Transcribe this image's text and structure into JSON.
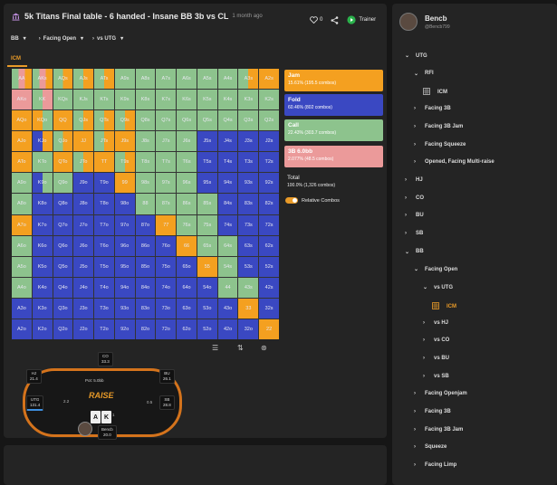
{
  "header": {
    "title": "5k Titans Final table - 6 handed - Insane BB 3b vs CL",
    "time": "1 month ago",
    "like_count": "0",
    "trainer_label": "Trainer"
  },
  "selectors": [
    "BB",
    "Facing Open",
    "vs UTG"
  ],
  "active_tab": "ICM",
  "grid": {
    "labels": [
      [
        "AA",
        "AKs",
        "AQs",
        "AJs",
        "ATs",
        "A9s",
        "A8s",
        "A7s",
        "A6s",
        "A5s",
        "A4s",
        "A3s",
        "A2s"
      ],
      [
        "AKo",
        "KK",
        "KQs",
        "KJs",
        "KTs",
        "K9s",
        "K8s",
        "K7s",
        "K6s",
        "K5s",
        "K4s",
        "K3s",
        "K2s"
      ],
      [
        "AQo",
        "KQo",
        "QQ",
        "QJs",
        "QTs",
        "Q9s",
        "Q8s",
        "Q7s",
        "Q6s",
        "Q5s",
        "Q4s",
        "Q3s",
        "Q2s"
      ],
      [
        "AJo",
        "KJo",
        "QJo",
        "JJ",
        "JTs",
        "J9s",
        "J8s",
        "J7s",
        "J6s",
        "J5s",
        "J4s",
        "J3s",
        "J2s"
      ],
      [
        "ATo",
        "KTo",
        "QTo",
        "JTo",
        "TT",
        "T9s",
        "T8s",
        "T7s",
        "T6s",
        "T5s",
        "T4s",
        "T3s",
        "T2s"
      ],
      [
        "A9o",
        "K9o",
        "Q9o",
        "J9o",
        "T9o",
        "99",
        "98s",
        "97s",
        "96s",
        "95s",
        "94s",
        "93s",
        "92s"
      ],
      [
        "A8o",
        "K8o",
        "Q8o",
        "J8o",
        "T8o",
        "98o",
        "88",
        "87s",
        "86s",
        "85s",
        "84s",
        "83s",
        "82s"
      ],
      [
        "A7o",
        "K7o",
        "Q7o",
        "J7o",
        "T7o",
        "97o",
        "87o",
        "77",
        "76s",
        "75s",
        "74s",
        "73s",
        "72s"
      ],
      [
        "A6o",
        "K6o",
        "Q6o",
        "J6o",
        "T6o",
        "96o",
        "86o",
        "76o",
        "66",
        "65s",
        "64s",
        "63s",
        "62s"
      ],
      [
        "A5o",
        "K5o",
        "Q5o",
        "J5o",
        "T5o",
        "95o",
        "85o",
        "75o",
        "65o",
        "55",
        "54s",
        "53s",
        "52s"
      ],
      [
        "A4o",
        "K4o",
        "Q4o",
        "J4o",
        "T4o",
        "94o",
        "84o",
        "74o",
        "64o",
        "54o",
        "44",
        "43s",
        "42s"
      ],
      [
        "A3o",
        "K3o",
        "Q3o",
        "J3o",
        "T3o",
        "93o",
        "83o",
        "73o",
        "63o",
        "53o",
        "43o",
        "33",
        "32s"
      ],
      [
        "A2o",
        "K2o",
        "Q2o",
        "J2o",
        "T2o",
        "92o",
        "82o",
        "72o",
        "62o",
        "52o",
        "42o",
        "32o",
        "22"
      ]
    ],
    "actions": [
      [
        "CRJ",
        "CRJ",
        "CJ",
        "CJ",
        "CJ",
        "C",
        "C",
        "C",
        "C",
        "C",
        "C",
        "CJ",
        "J"
      ],
      [
        "R",
        "CR",
        "C",
        "C",
        "C",
        "C",
        "C",
        "C",
        "C",
        "C",
        "C",
        "C",
        "C"
      ],
      [
        "J",
        "JC",
        "J",
        "CJ",
        "CJ",
        "CJ",
        "C",
        "C",
        "C",
        "C",
        "C",
        "C",
        "C"
      ],
      [
        "J",
        "FJ",
        "CJ",
        "J",
        "CJ",
        "J",
        "C",
        "C",
        "C",
        "F",
        "F",
        "F",
        "F"
      ],
      [
        "J",
        "C",
        "J",
        "CJ",
        "J",
        "CJ",
        "C",
        "C",
        "C",
        "F",
        "F",
        "F",
        "F"
      ],
      [
        "C",
        "FC",
        "C",
        "F",
        "F",
        "J",
        "C",
        "C",
        "C",
        "F",
        "F",
        "F",
        "F"
      ],
      [
        "C",
        "F",
        "F",
        "F",
        "F",
        "F",
        "C",
        "C",
        "C",
        "C",
        "F",
        "F",
        "F"
      ],
      [
        "J",
        "F",
        "F",
        "F",
        "F",
        "F",
        "F",
        "J",
        "C",
        "C",
        "F",
        "F",
        "F"
      ],
      [
        "C",
        "F",
        "F",
        "F",
        "F",
        "F",
        "F",
        "F",
        "J",
        "C",
        "C",
        "F",
        "F"
      ],
      [
        "C",
        "F",
        "F",
        "F",
        "F",
        "F",
        "F",
        "F",
        "F",
        "J",
        "C",
        "F",
        "F"
      ],
      [
        "C",
        "F",
        "F",
        "F",
        "F",
        "F",
        "F",
        "F",
        "F",
        "F",
        "C",
        "C",
        "F"
      ],
      [
        "F",
        "F",
        "F",
        "F",
        "F",
        "F",
        "F",
        "F",
        "F",
        "F",
        "F",
        "J",
        "F"
      ],
      [
        "F",
        "F",
        "F",
        "F",
        "F",
        "F",
        "F",
        "F",
        "F",
        "F",
        "F",
        "F",
        "J"
      ]
    ]
  },
  "legend": [
    {
      "name": "Jam",
      "pct": "15.61% (195.5 combos)",
      "color": "#f4a020",
      "text": "#ffffff"
    },
    {
      "name": "Fold",
      "pct": "60.46% (802 combos)",
      "color": "#3a48c2",
      "text": "#ffffff"
    },
    {
      "name": "Call",
      "pct": "22.43% (303.7 combos)",
      "color": "#8dc38d",
      "text": "#ffffff"
    },
    {
      "name": "3B 6.0bb",
      "pct": "2.077% (48.5 combos)",
      "color": "#eb9a9a",
      "text": "#ffffff"
    }
  ],
  "total": {
    "label": "Total",
    "value": "100.0% (1,326 combos)"
  },
  "toggle_label": "Relative Combos",
  "table": {
    "logo": "RAISE",
    "seats": [
      {
        "pos": "CO",
        "stack": "33.3"
      },
      {
        "pos": "HJ",
        "stack": "21.4"
      },
      {
        "pos": "BU",
        "stack": "26.1"
      },
      {
        "pos": "UTG",
        "stack": "131.4"
      },
      {
        "pos": "SB",
        "stack": "28.8"
      },
      {
        "pos": "Bencb",
        "stack": "20.0"
      }
    ],
    "pot": "Pot: 5.0bb",
    "hero_cards": [
      "A",
      "K"
    ],
    "chips": [
      "2.2",
      "0.5",
      "1"
    ]
  },
  "user": {
    "name": "Bencb",
    "handle": "@Bencb799"
  },
  "tree": [
    {
      "label": "UTG",
      "caret": "v",
      "indent": 0
    },
    {
      "label": "RFI",
      "caret": "v",
      "indent": 1
    },
    {
      "label": "ICM",
      "caret": "grid",
      "indent": 2
    },
    {
      "label": "Facing 3B",
      "caret": ">",
      "indent": 1
    },
    {
      "label": "Facing 3B Jam",
      "caret": ">",
      "indent": 1
    },
    {
      "label": "Facing Squeeze",
      "caret": ">",
      "indent": 1
    },
    {
      "label": "Opened, Facing Multi-raise",
      "caret": ">",
      "indent": 1
    },
    {
      "label": "HJ",
      "caret": ">",
      "indent": 0
    },
    {
      "label": "CO",
      "caret": ">",
      "indent": 0
    },
    {
      "label": "BU",
      "caret": ">",
      "indent": 0
    },
    {
      "label": "SB",
      "caret": ">",
      "indent": 0
    },
    {
      "label": "BB",
      "caret": "v",
      "indent": 0
    },
    {
      "label": "Facing Open",
      "caret": "v",
      "indent": 1
    },
    {
      "label": "vs UTG",
      "caret": "v",
      "indent": 2
    },
    {
      "label": "ICM",
      "caret": "grid-active",
      "indent": 3
    },
    {
      "label": "vs HJ",
      "caret": ">",
      "indent": 2
    },
    {
      "label": "vs CO",
      "caret": ">",
      "indent": 2
    },
    {
      "label": "vs BU",
      "caret": ">",
      "indent": 2
    },
    {
      "label": "vs SB",
      "caret": ">",
      "indent": 2
    },
    {
      "label": "Facing Openjam",
      "caret": ">",
      "indent": 1
    },
    {
      "label": "Facing 3B",
      "caret": ">",
      "indent": 1
    },
    {
      "label": "Facing 3B Jam",
      "caret": ">",
      "indent": 1
    },
    {
      "label": "Squeeze",
      "caret": ">",
      "indent": 1
    },
    {
      "label": "Facing Limp",
      "caret": ">",
      "indent": 1
    }
  ]
}
